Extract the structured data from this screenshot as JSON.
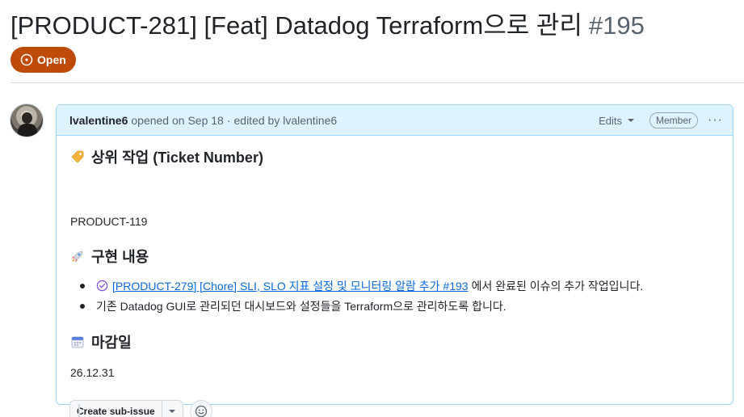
{
  "issue": {
    "title": "[PRODUCT-281] [Feat] Datadog Terraform으로 관리",
    "number": "#195",
    "state": "Open",
    "state_color": "#bf4b08"
  },
  "comment": {
    "author": "lvalentine6",
    "opened_text": "opened on Sep 18",
    "separator": "·",
    "edited_text": "edited by lvalentine6",
    "edits_label": "Edits",
    "role_badge": "Member",
    "more_label": "···",
    "border_color": "#9cd7ff",
    "header_bg": "#ddf4ff"
  },
  "body": {
    "section1_heading": "상위 작업 (Ticket Number)",
    "section1_icon": "label-tag-emoji",
    "section1_text": "PRODUCT-119",
    "section2_heading": "구현 내용",
    "section2_icon": "rocket-emoji",
    "items": [
      {
        "link_text": "[PRODUCT-279] [Chore] SLI, SLO 지표 설정 및 모니터링 알람 추가 #193",
        "after_text": "에서 완료된 이슈의 추가 작업입니다."
      },
      {
        "text": "기존 Datadog GUI로 관리되던 대시보드와 설정들을 Terraform으로 관리하도록 합니다."
      }
    ],
    "section3_heading": "마감일",
    "section3_icon": "calendar-emoji",
    "section3_text": "26.12.31"
  },
  "actions": {
    "create_sub_issue_label": "Create sub-issue"
  },
  "colors": {
    "link": "#0969da",
    "muted": "#59636e",
    "text": "#1f2328",
    "closed_purple": "#8250df"
  }
}
